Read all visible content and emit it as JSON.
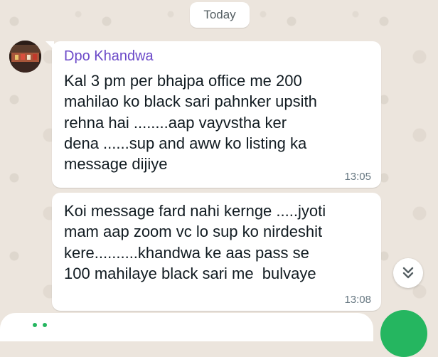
{
  "date_chip": "Today",
  "messages": [
    {
      "sender": "Dpo Khandwa",
      "lines": [
        "Kal 3 pm per bhajpa office me 200",
        "mahilao ko black sari pahnker upsith",
        "rehna hai ........aap vayvstha ker",
        "dena ......sup and aww ko listing ka",
        "message dijiye"
      ],
      "time": "13:05"
    },
    {
      "lines": [
        "Koi message fard nahi kernge .....jyoti",
        "mam aap zoom vc lo sup ko nirdeshit",
        "kere..........khandwa ke aas pass se",
        "100 mahilaye black sari me  bulvaye"
      ],
      "time": "13:08"
    }
  ],
  "icons": {
    "scroll_down": "double-chevron-down-icon",
    "avatar": "group-photo-avatar"
  },
  "colors": {
    "background": "#ece5dd",
    "bubble": "#ffffff",
    "sender_name": "#6b49c8",
    "text": "#111b21",
    "timestamp": "#667781",
    "accent_green": "#25b660"
  }
}
